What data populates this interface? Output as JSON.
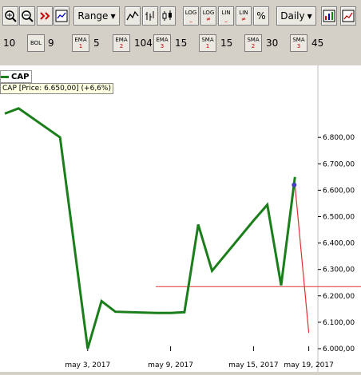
{
  "toolbar": {
    "range_label": "Range",
    "daily_label": "Daily",
    "log1_label": "LOG",
    "log2_label": "LOG",
    "lin1_label": "LIN",
    "lin2_label": "LIN",
    "pct_label": "%"
  },
  "indicators": {
    "period_value": "10",
    "bol_label": "BOL",
    "bol_value": "9",
    "ema1_label": "EMA",
    "ema1_num": "1",
    "ema1_value": "5",
    "ema2_label": "EMA",
    "ema2_num": "2",
    "ema2_value": "104",
    "ema3_label": "EMA",
    "ema3_num": "3",
    "ema3_value": "15",
    "sma1_label": "SMA",
    "sma1_num": "1",
    "sma1_value": "15",
    "sma2_label": "SMA",
    "sma2_num": "2",
    "sma2_value": "30",
    "sma3_label": "SMA",
    "sma3_num": "3",
    "sma3_value": "45"
  },
  "legend": {
    "name": "CAP"
  },
  "info": {
    "text": "CAP [Price: 6.650,00] (+6,6%)"
  },
  "colors": {
    "series": "#1a7f1a",
    "trendline": "#e03030",
    "marker": "#4040c0"
  },
  "chart_data": {
    "type": "line",
    "series": [
      {
        "name": "CAP",
        "points": [
          {
            "d": "2017-04-27",
            "v": 6890
          },
          {
            "d": "2017-04-28",
            "v": 6910
          },
          {
            "d": "2017-05-01",
            "v": 6800
          },
          {
            "d": "2017-05-02",
            "v": 6400
          },
          {
            "d": "2017-05-03",
            "v": 6000
          },
          {
            "d": "2017-05-04",
            "v": 6180
          },
          {
            "d": "2017-05-05",
            "v": 6140
          },
          {
            "d": "2017-05-08",
            "v": 6135
          },
          {
            "d": "2017-05-09",
            "v": 6135
          },
          {
            "d": "2017-05-10",
            "v": 6138
          },
          {
            "d": "2017-05-11",
            "v": 6470
          },
          {
            "d": "2017-05-12",
            "v": 6295
          },
          {
            "d": "2017-05-15",
            "v": 6485
          },
          {
            "d": "2017-05-16",
            "v": 6545
          },
          {
            "d": "2017-05-17",
            "v": 6240
          },
          {
            "d": "2017-05-18",
            "v": 6650
          }
        ]
      }
    ],
    "yticks": [
      "6.000,00",
      "6.100,00",
      "6.200,00",
      "6.300,00",
      "6.400,00",
      "6.500,00",
      "6.600,00",
      "6.700,00",
      "6.800,00"
    ],
    "ytick_values": [
      6000,
      6100,
      6200,
      6300,
      6400,
      6500,
      6600,
      6700,
      6800
    ],
    "xticks": [
      "may 3, 2017",
      "may 9, 2017",
      "may 15, 2017",
      "may 19, 2017"
    ],
    "xtick_dates": [
      "2017-05-03",
      "2017-05-09",
      "2017-05-15",
      "2017-05-19"
    ],
    "ylim": [
      5980,
      6980
    ],
    "hline_value": 6235,
    "trend_line": [
      {
        "d": "2017-05-18",
        "v": 6620
      },
      {
        "d": "2017-05-19",
        "v": 6060
      }
    ],
    "marker": {
      "d": "2017-05-18",
      "v": 6620
    },
    "grid": false
  }
}
